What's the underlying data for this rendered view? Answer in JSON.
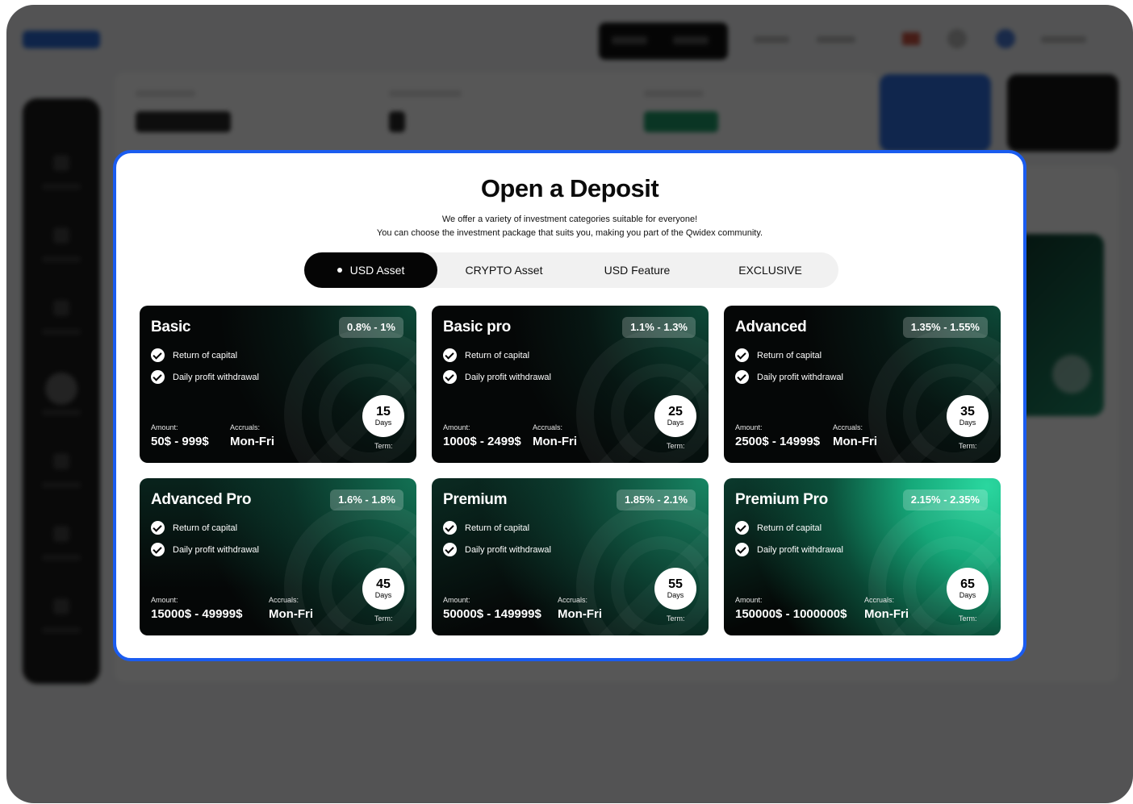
{
  "modal": {
    "title": "Open a Deposit",
    "subtitle_line1": "We offer a variety of investment categories suitable for everyone!",
    "subtitle_line2": "You can choose the investment package that suits you, making you part of the Qwidex community."
  },
  "tabs": [
    {
      "label": "USD Asset",
      "active": true
    },
    {
      "label": "CRYPTO Asset",
      "active": false
    },
    {
      "label": "USD Feature",
      "active": false
    },
    {
      "label": "EXCLUSIVE",
      "active": false
    }
  ],
  "labels": {
    "feature_1": "Return of capital",
    "feature_2": "Daily profit withdrawal",
    "amount": "Amount:",
    "accruals": "Accruals:",
    "term": "Term:",
    "days": "Days"
  },
  "cards": [
    {
      "name": "Basic",
      "rate": "0.8% - 1%",
      "amount": "50$ - 999$",
      "accruals": "Mon-Fri",
      "days": "15"
    },
    {
      "name": "Basic pro",
      "rate": "1.1% - 1.3%",
      "amount": "1000$ - 2499$",
      "accruals": "Mon-Fri",
      "days": "25"
    },
    {
      "name": "Advanced",
      "rate": "1.35% - 1.55%",
      "amount": "2500$ - 14999$",
      "accruals": "Mon-Fri",
      "days": "35"
    },
    {
      "name": "Advanced Pro",
      "rate": "1.6% - 1.8%",
      "amount": "15000$ - 49999$",
      "accruals": "Mon-Fri",
      "days": "45"
    },
    {
      "name": "Premium",
      "rate": "1.85% - 2.1%",
      "amount": "50000$ - 149999$",
      "accruals": "Mon-Fri",
      "days": "55"
    },
    {
      "name": "Premium Pro",
      "rate": "2.15% - 2.35%",
      "amount": "150000$ - 1000000$",
      "accruals": "Mon-Fri",
      "days": "65"
    }
  ],
  "colors": {
    "modal_border": "#1a5cf0",
    "active_tab": "#050505",
    "card_green": "#16a97a"
  }
}
